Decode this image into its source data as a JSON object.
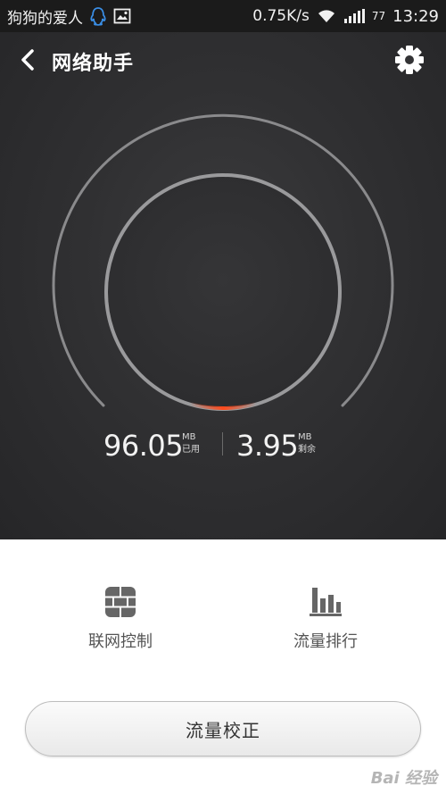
{
  "status_bar": {
    "carrier": "狗狗的爱人",
    "speed": "0.75K/s",
    "battery": "77",
    "time": "13:29"
  },
  "header": {
    "title": "网络助手"
  },
  "usage": {
    "used_value": "96.05",
    "used_unit": "MB",
    "used_label": "已用",
    "remaining_value": "3.95",
    "remaining_unit": "MB",
    "remaining_label": "剩余"
  },
  "actions": {
    "firewall_label": "联网控制",
    "ranking_label": "流量排行"
  },
  "calibrate_button": "流量校正",
  "watermark": "Bai 经验",
  "colors": {
    "accent_indicator": "#ff4a1c",
    "panel_dark": "#303032"
  }
}
